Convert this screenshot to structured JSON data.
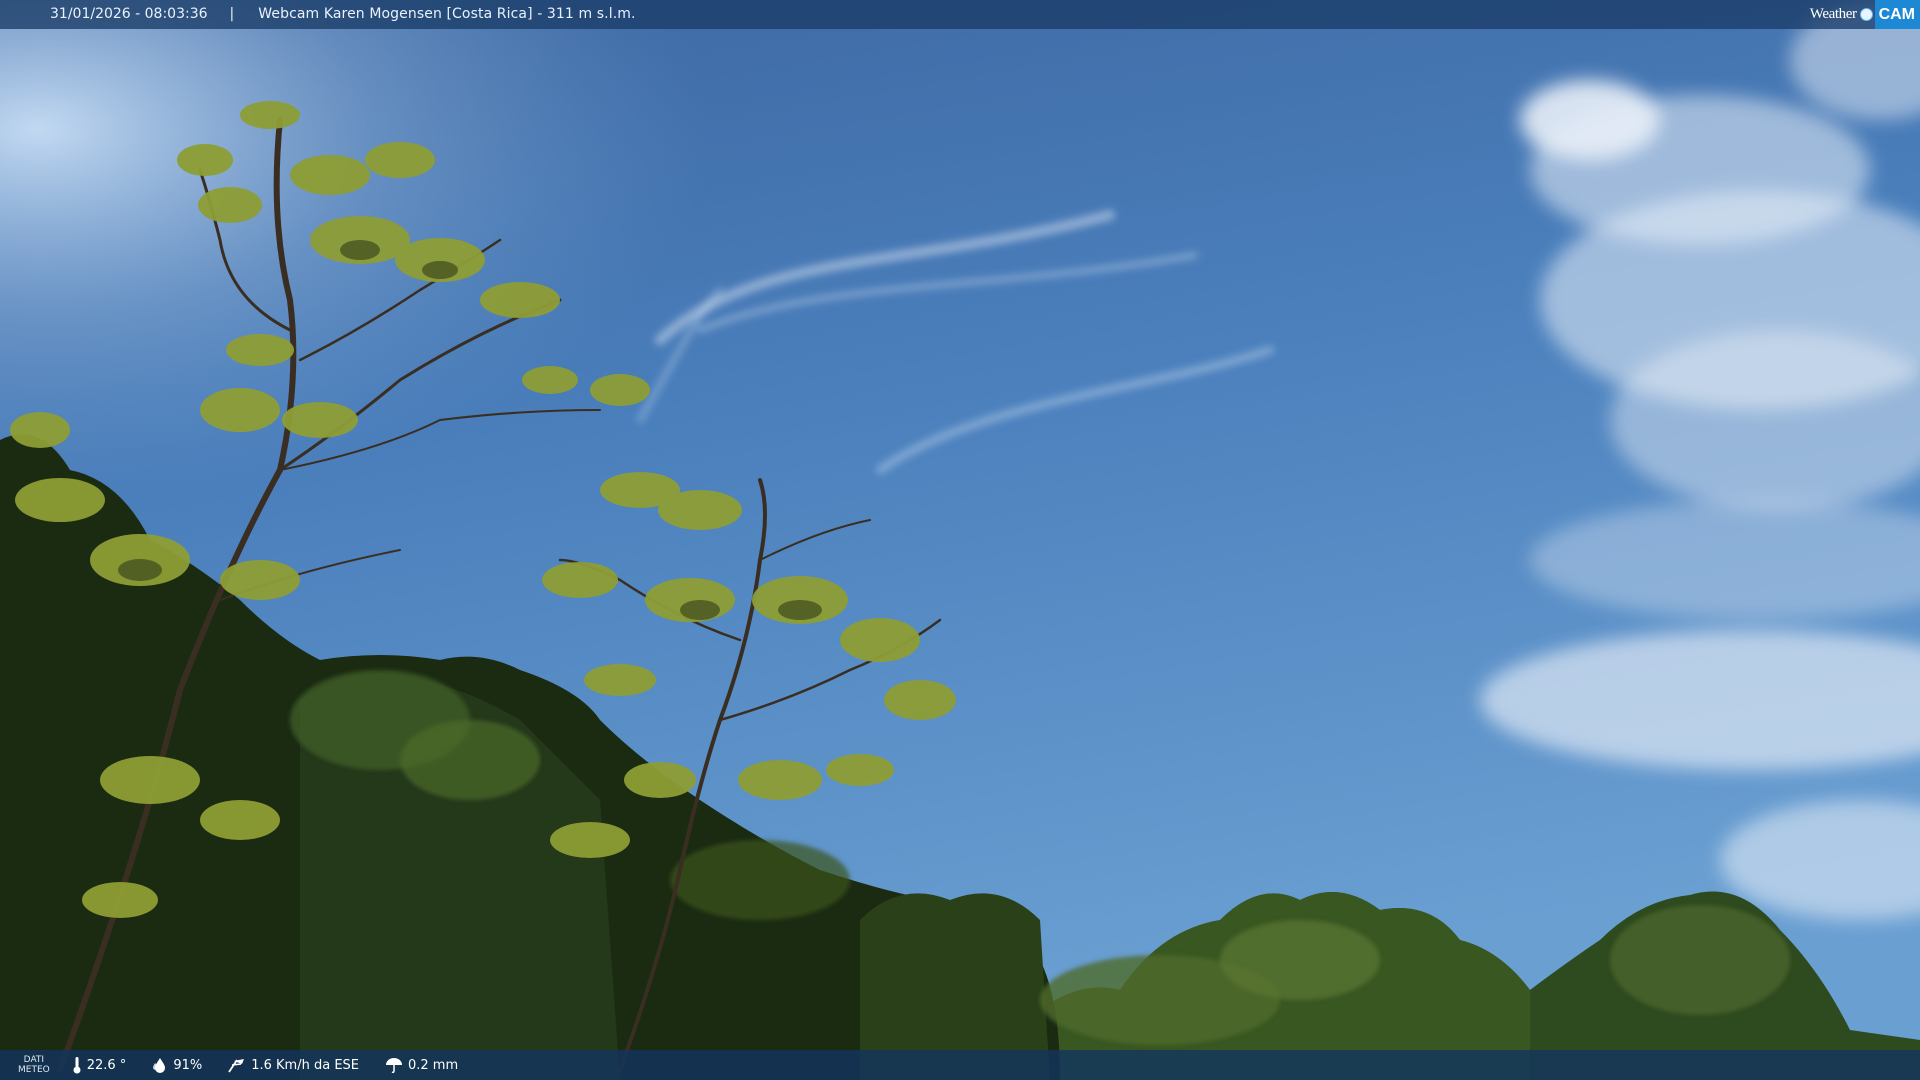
{
  "header": {
    "timestamp": "31/01/2026 - 08:03:36",
    "separator": "|",
    "title": "Webcam Karen Mogensen [Costa Rica]  - 311 m s.l.m."
  },
  "brand": {
    "weather_text": "Weather",
    "cam_text": "CAM"
  },
  "weather_bar": {
    "label_line1": "DATI",
    "label_line2": "METEO",
    "temperature": "22.6 °",
    "humidity": "91%",
    "wind": "1.6 Km/h da ESE",
    "rain": "0.2 mm",
    "icons": [
      "thermometer-icon",
      "humidity-drop-icon",
      "wind-icon",
      "rain-umbrella-icon"
    ]
  },
  "colors": {
    "sky_top": "#3b6aa6",
    "sky_bottom": "#5a8fc8",
    "foliage_dark": "#17260f",
    "foliage_light": "#9aaa3e",
    "bar_bg": "#1a3c68",
    "brand_blue": "#1d89d4"
  }
}
